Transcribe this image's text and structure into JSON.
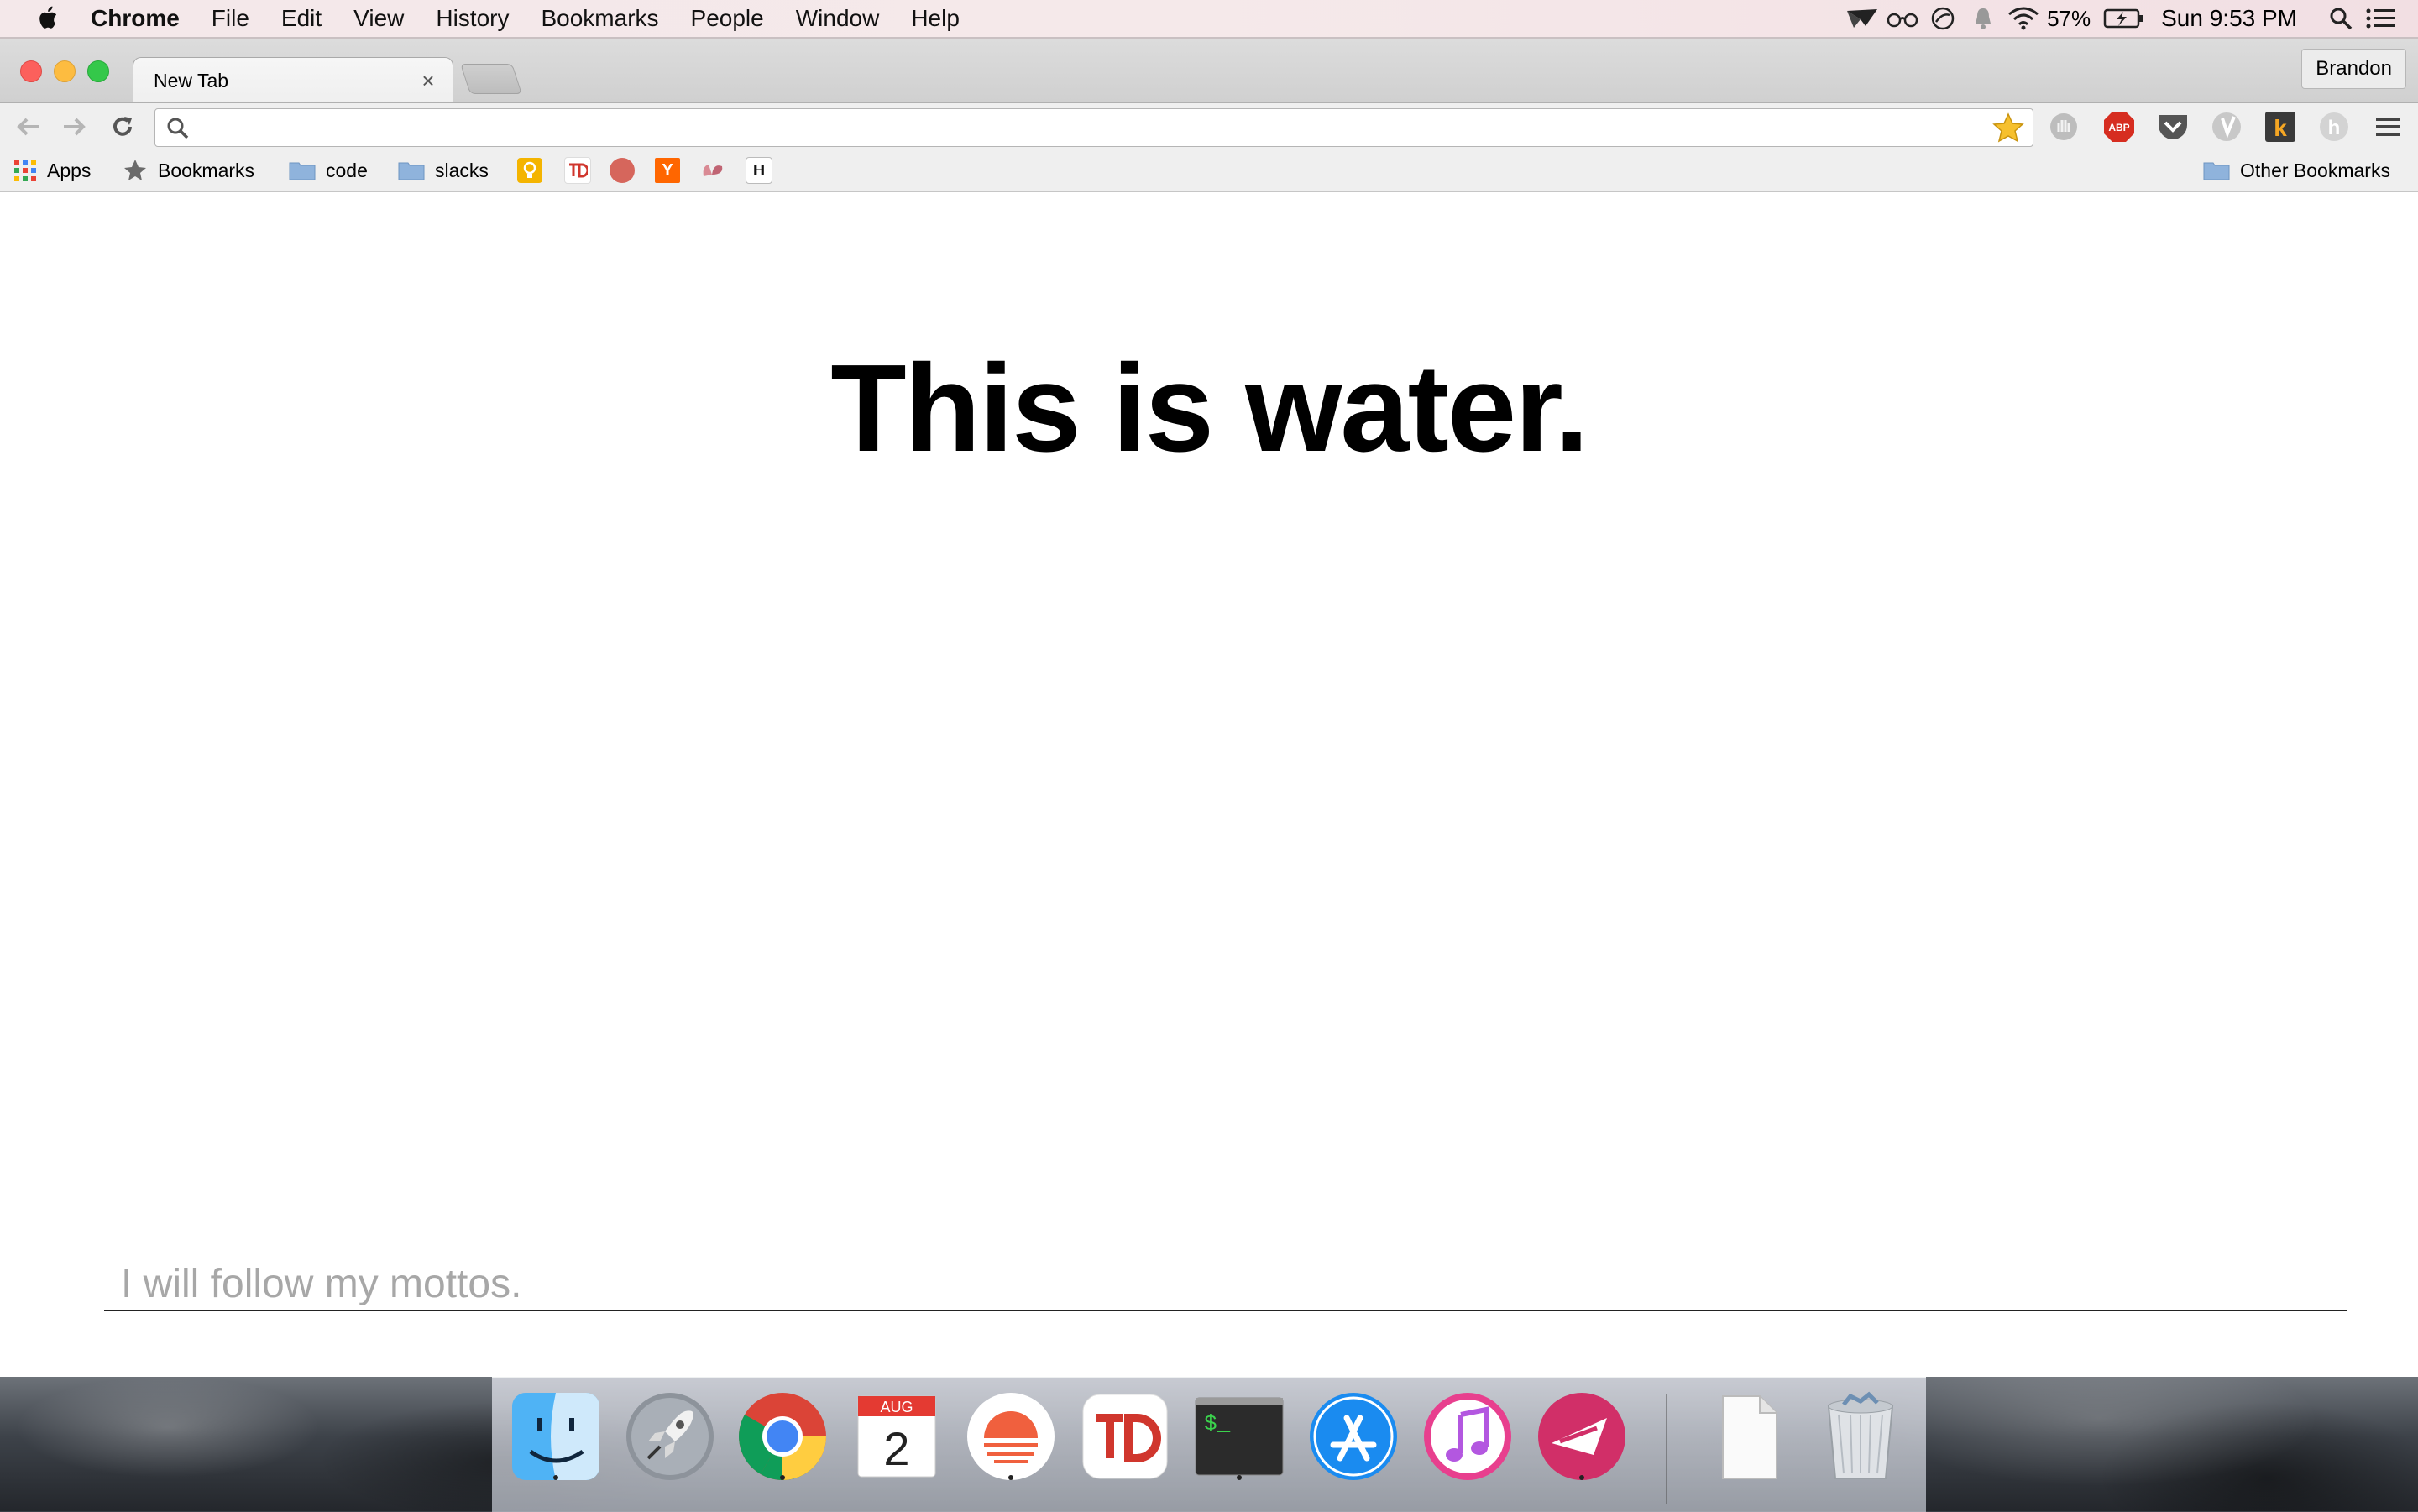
{
  "menubar": {
    "app_name": "Chrome",
    "menus": [
      "File",
      "Edit",
      "View",
      "History",
      "Bookmarks",
      "People",
      "Window",
      "Help"
    ],
    "battery": "57%",
    "clock": "Sun 9:53 PM"
  },
  "browser": {
    "tab_title": "New Tab",
    "profile_name": "Brandon",
    "omnibox_value": "",
    "bookmarks": [
      {
        "label": "Apps"
      },
      {
        "label": "Bookmarks"
      },
      {
        "label": "code"
      },
      {
        "label": "slacks"
      }
    ],
    "bookmark_favicons": [
      "lightbulb",
      "todoist",
      "red-circle",
      "ycombinator",
      "chrome-ext",
      "hyperlink-h"
    ],
    "other_bookmarks": "Other Bookmarks",
    "extensions": [
      "hand-ext-icon",
      "adblock-plus-icon",
      "pocket-icon",
      "vimium-icon",
      "kiwi-icon",
      "hypothesis-icon",
      "chrome-menu-icon"
    ],
    "abp_text": "ABP",
    "kiwi_letter": "k",
    "hyp_letter": "h"
  },
  "page": {
    "heading": "This is water.",
    "motto_placeholder": "I will follow my mottos.",
    "motto_value": ""
  },
  "dock": {
    "apps": [
      "Finder",
      "Launchpad",
      "Chrome",
      "Calendar",
      "Sunrise",
      "Todoist",
      "Terminal",
      "App Store",
      "iTunes",
      "Skitch",
      "Document",
      "Trash"
    ],
    "calendar_month": "AUG",
    "calendar_day": "2",
    "terminal_prompt": "$_"
  },
  "colors": {
    "close": "#fc605c",
    "minimize": "#fdbc40",
    "maximize": "#34c84a",
    "abp_red": "#d62d20",
    "star": "#f6c02e"
  }
}
